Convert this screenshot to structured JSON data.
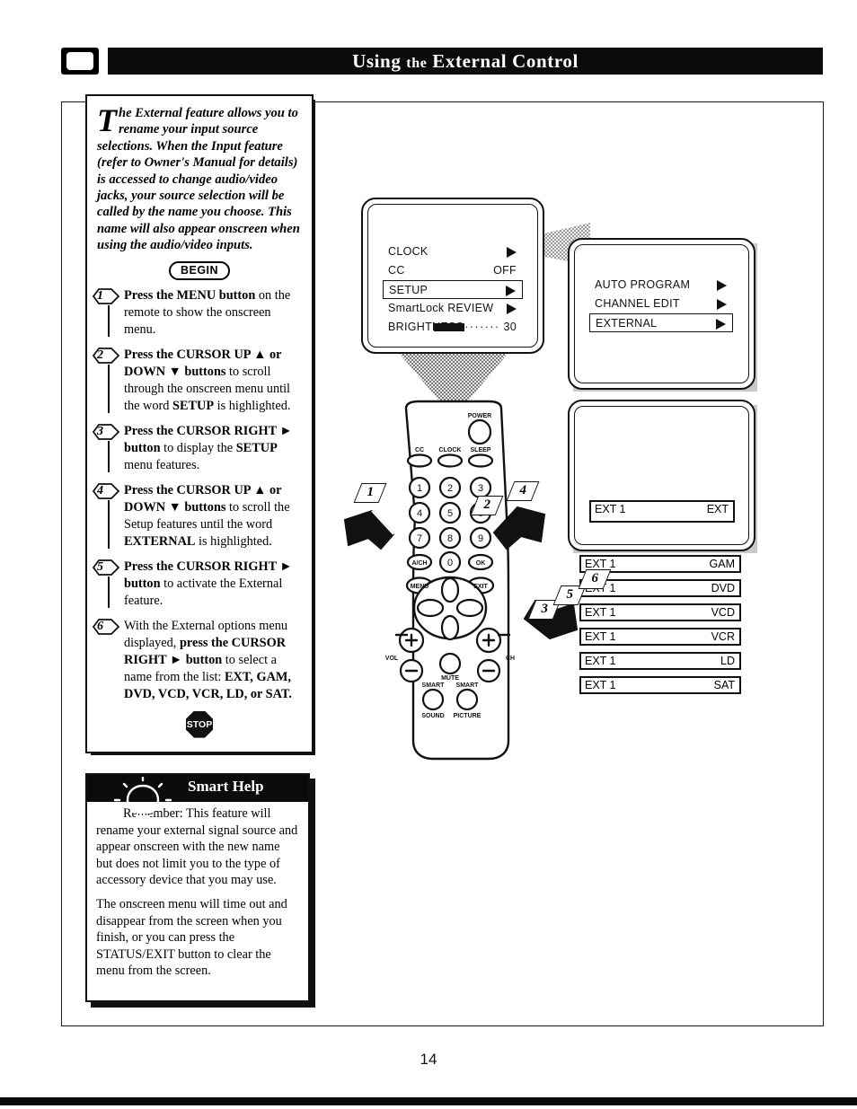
{
  "header": {
    "title_words": [
      "Using",
      "the",
      "External",
      "Control"
    ],
    "title_plain": "USING THE EXTERNAL CONTROL"
  },
  "page": {
    "number": "14"
  },
  "intro": {
    "dropcap": "T",
    "text": "he External feature allows you to rename your input source selections. When the Input feature (refer to Owner's Manual for details) is accessed to change audio/video jacks, your source selection will be called by the name you choose. This name will also appear onscreen when using the audio/video inputs."
  },
  "badges": {
    "begin": "BEGIN",
    "stop": "STOP"
  },
  "steps": [
    {
      "num": "1",
      "html": "<b>Press the MENU button</b> on the remote to show the onscreen menu."
    },
    {
      "num": "2",
      "html": "<b>Press the CURSOR UP &#9650; or DOWN &#9660; buttons</b> to scroll through the onscreen menu until the word <b>SETUP</b> is highlighted."
    },
    {
      "num": "3",
      "html": "<b>Press the CURSOR RIGHT &#9658; button</b> to display the <b>SETUP</b> menu features."
    },
    {
      "num": "4",
      "html": "<b>Press the CURSOR UP &#9650; or DOWN &#9660; buttons</b> to scroll the Setup features until the word <b>EXTERNAL</b> is highlighted."
    },
    {
      "num": "5",
      "html": "<b>Press the CURSOR RIGHT &#9658; button</b> to activate the External feature."
    },
    {
      "num": "6",
      "html": "With the External options menu displayed, <b>press the CURSOR RIGHT &#9658; button</b> to select a name from the list: <b>EXT, GAM, DVD, VCD, VCR, LD, or SAT.</b>"
    }
  ],
  "smart_help": {
    "title_words": [
      "Smart",
      "Help"
    ],
    "paragraphs": [
      "Remember: This feature will rename your external signal source and appear onscreen with the new name but does not limit you to the type of accessory device that you may use.",
      "The onscreen menu will time out and disappear from the screen when you finish, or you can press the STATUS/EXIT button to clear the menu from the screen."
    ]
  },
  "tv_main_menu": {
    "rows": [
      {
        "label": "CLOCK",
        "value": "",
        "arrow": true,
        "highlighted": false
      },
      {
        "label": "CC",
        "value": "OFF",
        "arrow": false,
        "highlighted": false
      },
      {
        "label": "SETUP",
        "value": "",
        "arrow": true,
        "highlighted": true
      },
      {
        "label": "SmartLock REVIEW",
        "value": "",
        "arrow": true,
        "highlighted": false
      },
      {
        "label": "BRIGHTNESS",
        "value": "30",
        "arrow": false,
        "highlighted": false,
        "bar": 30
      }
    ]
  },
  "tv_setup_menu": {
    "rows": [
      {
        "label": "AUTO PROGRAM",
        "arrow": true,
        "highlighted": false
      },
      {
        "label": "CHANNEL EDIT",
        "arrow": true,
        "highlighted": false
      },
      {
        "label": "EXTERNAL",
        "arrow": true,
        "highlighted": true
      }
    ]
  },
  "tv_external_screen": {
    "left": "EXT 1",
    "right": "EXT"
  },
  "name_options": [
    {
      "left": "EXT 1",
      "right": "GAM"
    },
    {
      "left": "EXT 1",
      "right": "DVD"
    },
    {
      "left": "EXT 1",
      "right": "VCD"
    },
    {
      "left": "EXT 1",
      "right": "VCR"
    },
    {
      "left": "EXT 1",
      "right": "LD"
    },
    {
      "left": "EXT 1",
      "right": "SAT"
    }
  ],
  "remote": {
    "power": "POWER",
    "top_row": [
      "CC",
      "CLOCK",
      "SLEEP"
    ],
    "keypad": [
      "1",
      "2",
      "3",
      "4",
      "5",
      "6",
      "7",
      "8",
      "9",
      "0"
    ],
    "ach": "A/CH",
    "menu": "MENU",
    "exit": "EXIT",
    "ok": "OK",
    "vol": "VOL",
    "ch": "CH",
    "mute": "MUTE",
    "smart_sound": [
      "SMART",
      "SOUND"
    ],
    "smart_picture": [
      "SMART",
      "PICTURE"
    ]
  },
  "callouts": [
    "1",
    "2",
    "3",
    "4",
    "5",
    "6"
  ],
  "colors": {
    "ink": "#111111",
    "paper": "#ffffff",
    "shadow": "#c2c2c2"
  }
}
